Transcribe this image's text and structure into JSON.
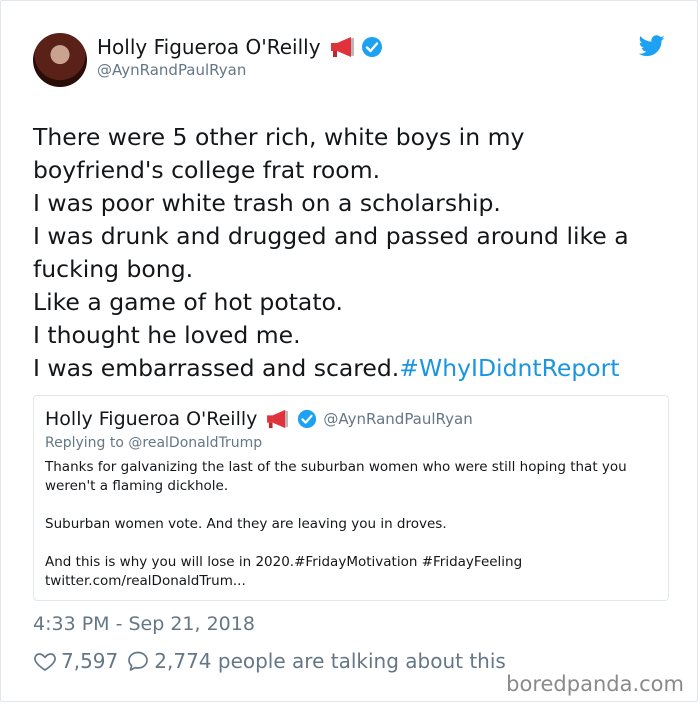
{
  "tweet": {
    "author_name": "Holly Figueroa O'Reilly",
    "author_handle": "@AynRandPaulRyan",
    "text_lines": [
      "There were 5 other rich, white boys in my",
      "boyfriend's college frat room.",
      "I was poor white trash on a scholarship.",
      "I was drunk and drugged and passed around like a",
      "fucking bong.",
      "Like a game of hot potato.",
      "I thought he loved me.",
      "I was embarrassed and scared."
    ],
    "hashtag": "#WhyIDidntReport",
    "timestamp": "4:33 PM - Sep 21, 2018",
    "likes": "7,597",
    "replies_text": "2,774 people are talking about this"
  },
  "quote": {
    "author_name": "Holly Figueroa O'Reilly",
    "author_handle": "@AynRandPaulRyan",
    "replying_to": "Replying to @realDonaldTrump",
    "para1_line1": "Thanks for galvanizing the last of the suburban women who were still hoping that you",
    "para1_line2": "weren't a flaming dickhole.",
    "para2": "Suburban women vote. And they are leaving you in droves.",
    "para3_line1": "And this is why you will lose in 2020.#FridayMotivation #FridayFeeling",
    "para3_line2": "twitter.com/realDonaldTrum..."
  },
  "watermark": "boredpanda.com",
  "icons": {
    "megaphone": "megaphone-icon",
    "verified": "verified-badge-icon",
    "bird": "twitter-bird-icon",
    "heart": "heart-icon",
    "reply": "reply-bubble-icon"
  },
  "colors": {
    "link": "#1b95e0",
    "muted": "#657786",
    "verified": "#1da1f2",
    "megaphone": "#e0323a"
  }
}
